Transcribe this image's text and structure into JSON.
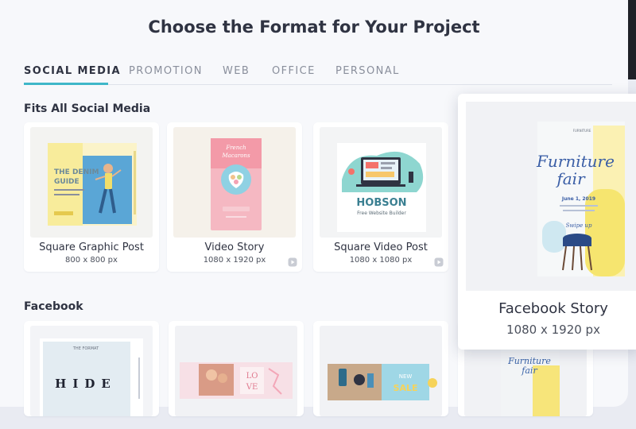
{
  "page": {
    "title": "Choose the Format for Your Project"
  },
  "tabs": [
    {
      "label": "SOCIAL MEDIA"
    },
    {
      "label": "PROMOTION"
    },
    {
      "label": "WEB"
    },
    {
      "label": "OFFICE"
    },
    {
      "label": "PERSONAL"
    }
  ],
  "sections": {
    "social": {
      "title": "Fits All Social Media",
      "cards": [
        {
          "name": "Square Graphic Post",
          "size": "800 x 800 px",
          "thumb": {
            "headline": "THE DENIM GUIDE",
            "subline": "Find your perfect pair of jeans"
          }
        },
        {
          "name": "Video Story",
          "size": "1080 x 1920 px",
          "thumb": {
            "headline": "French Macarons"
          }
        },
        {
          "name": "Square Video Post",
          "size": "1080 x 1080 px",
          "thumb": {
            "headline": "HOBSON",
            "subline": "Free Website Builder"
          }
        }
      ]
    },
    "facebook": {
      "title": "Facebook",
      "cards": [
        {
          "thumb": {
            "headline": "HIDE",
            "kicker": "THE FORMAT"
          }
        },
        {
          "thumb": {
            "headline": "LOVE"
          }
        },
        {
          "thumb": {
            "headline": "NEW SALE"
          }
        }
      ]
    }
  },
  "popup": {
    "name": "Facebook Story",
    "size": "1080 x 1920 px",
    "thumb": {
      "headline": "Furniture fair",
      "date": "June 1, 2019",
      "cta": "Swipe up"
    }
  },
  "partial_card": {
    "headline": "Furniture fair"
  },
  "colors": {
    "accent": "#3fb7c9",
    "text": "#2f3342",
    "muted": "#8a8f9c"
  },
  "icons": {
    "video": "video-play-icon"
  }
}
